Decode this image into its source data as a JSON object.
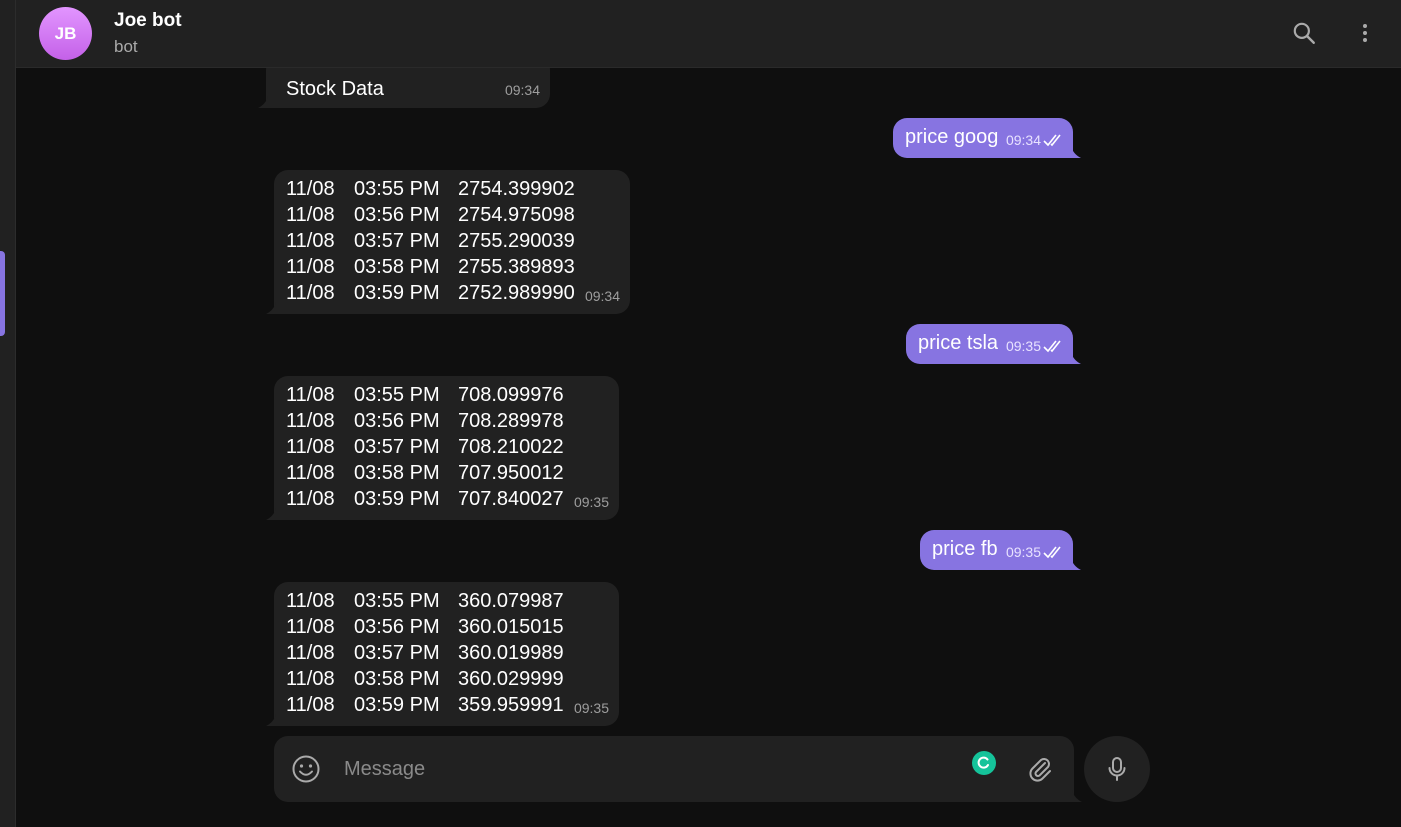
{
  "header": {
    "avatar_initials": "JB",
    "title": "Joe bot",
    "status": "bot"
  },
  "colors": {
    "background": "#0f0f0f",
    "panel": "#212121",
    "accent": "#8774e1",
    "avatar": "#d07ef2"
  },
  "messages": [
    {
      "direction": "in",
      "text": "Stock Data",
      "time": "09:34"
    },
    {
      "direction": "out",
      "text": "price goog",
      "time": "09:34",
      "read": true
    },
    {
      "direction": "in",
      "time": "09:34",
      "rows": [
        {
          "date": "11/08",
          "time": "03:55 PM",
          "price": "2754.399902"
        },
        {
          "date": "11/08",
          "time": "03:56 PM",
          "price": "2754.975098"
        },
        {
          "date": "11/08",
          "time": "03:57 PM",
          "price": "2755.290039"
        },
        {
          "date": "11/08",
          "time": "03:58 PM",
          "price": "2755.389893"
        },
        {
          "date": "11/08",
          "time": "03:59 PM",
          "price": "2752.989990"
        }
      ]
    },
    {
      "direction": "out",
      "text": "price tsla",
      "time": "09:35",
      "read": true
    },
    {
      "direction": "in",
      "time": "09:35",
      "rows": [
        {
          "date": "11/08",
          "time": "03:55 PM",
          "price": "708.099976"
        },
        {
          "date": "11/08",
          "time": "03:56 PM",
          "price": "708.289978"
        },
        {
          "date": "11/08",
          "time": "03:57 PM",
          "price": "708.210022"
        },
        {
          "date": "11/08",
          "time": "03:58 PM",
          "price": "707.950012"
        },
        {
          "date": "11/08",
          "time": "03:59 PM",
          "price": "707.840027"
        }
      ]
    },
    {
      "direction": "out",
      "text": "price fb",
      "time": "09:35",
      "read": true
    },
    {
      "direction": "in",
      "time": "09:35",
      "rows": [
        {
          "date": "11/08",
          "time": "03:55 PM",
          "price": "360.079987"
        },
        {
          "date": "11/08",
          "time": "03:56 PM",
          "price": "360.015015"
        },
        {
          "date": "11/08",
          "time": "03:57 PM",
          "price": "360.019989"
        },
        {
          "date": "11/08",
          "time": "03:58 PM",
          "price": "360.029999"
        },
        {
          "date": "11/08",
          "time": "03:59 PM",
          "price": "359.959991"
        }
      ]
    }
  ],
  "composer": {
    "placeholder": "Message"
  },
  "icons": {
    "search": "search-icon",
    "more": "more-vertical-icon",
    "emoji": "smile-icon",
    "attach": "paperclip-icon",
    "mic": "microphone-icon",
    "read_receipt": "double-check-icon"
  }
}
